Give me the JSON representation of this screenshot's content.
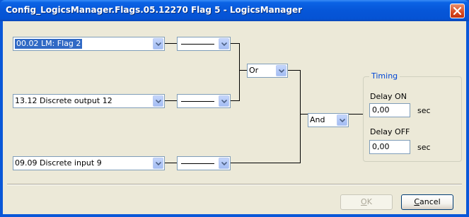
{
  "window": {
    "title": "Config_LogicsManager.Flags.05.12270 Flag 5 - LogicsManager"
  },
  "inputs": [
    {
      "value": "00.02 LM: Flag 2",
      "selected": true
    },
    {
      "value": "13.12 Discrete output 12",
      "selected": false
    },
    {
      "value": "09.09 Discrete input 9",
      "selected": false
    }
  ],
  "negations": [
    {
      "value": "—"
    },
    {
      "value": "—"
    },
    {
      "value": "—"
    }
  ],
  "gates": {
    "first": "Or",
    "second": "And"
  },
  "timing": {
    "legend": "Timing",
    "delay_on_label": "Delay ON",
    "delay_on_value": "0,00",
    "delay_on_unit": "sec",
    "delay_off_label": "Delay OFF",
    "delay_off_value": "0,00",
    "delay_off_unit": "sec"
  },
  "buttons": {
    "ok_label": "OK",
    "ok_mnemonic": "O",
    "ok_rest": "K",
    "cancel_mnemonic": "C",
    "cancel_rest": "ancel",
    "cancel_label": "Cancel",
    "ok_enabled": false
  },
  "colors": {
    "titlebar": "#0656d8",
    "dialog_bg": "#ece9d8",
    "selection": "#316ac5",
    "group_legend": "#0046d5"
  },
  "icons": {
    "close": "close-icon",
    "dropdown": "chevron-down-icon"
  }
}
